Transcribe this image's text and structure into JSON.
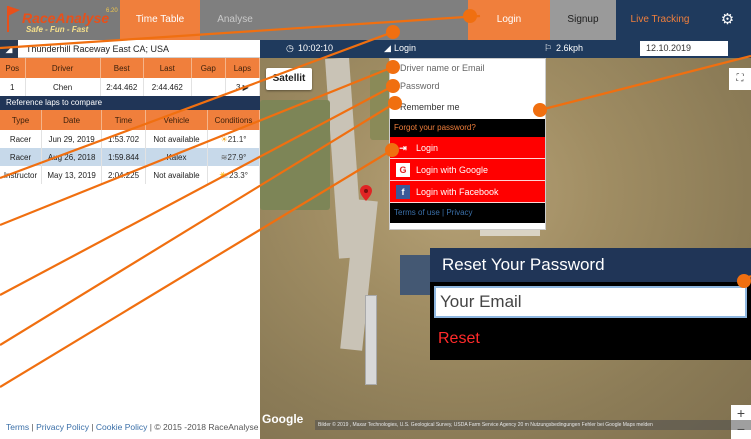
{
  "brand": {
    "name": "RaceAnalyse",
    "version": "6.20",
    "tagline": "Safe - Fun - Fast"
  },
  "nav": {
    "timetable": "Time Table",
    "analyse": "Analyse",
    "login": "Login",
    "signup": "Signup",
    "live": "Live Tracking",
    "settings_icon": "gear-icon"
  },
  "track": {
    "name": "Thunderhill Raceway East CA; USA"
  },
  "table": {
    "columns": [
      "Pos",
      "Driver",
      "Best",
      "Last",
      "Gap",
      "Laps"
    ],
    "rows": [
      {
        "pos": "1",
        "driver": "Chen",
        "best": "2:44.462",
        "last": "2:44.462",
        "gap": "",
        "laps": "3"
      }
    ]
  },
  "reference": {
    "caption": "Reference laps to compare",
    "columns": [
      "Type",
      "Date",
      "Time",
      "Vehicle",
      "Conditions"
    ],
    "rows": [
      {
        "type": "Racer",
        "date": "Jun 29, 2019",
        "time": "1:53.702",
        "vehicle": "Not available",
        "cond": "21.1°",
        "icon": "sun-icon"
      },
      {
        "type": "Racer",
        "date": "Aug 26, 2018",
        "time": "1:59.844",
        "vehicle": "Kalex",
        "cond": "27.9°",
        "icon": "wind-icon"
      },
      {
        "type": "Instructor",
        "date": "May 13, 2019",
        "time": "2:04.225",
        "vehicle": "Not available",
        "cond": "23.3°",
        "icon": "partly-cloudy-icon"
      }
    ]
  },
  "footer": {
    "terms": "Terms",
    "privacy": "Privacy Policy",
    "cookie": "Cookie Policy",
    "copy": "© 2015 -2018 RaceAnalyse"
  },
  "mapbar": {
    "clock": "10:02:10",
    "login_label": "Login",
    "speed": "2.6kph",
    "date": "12.10.2019"
  },
  "map": {
    "satellite": "Satellit",
    "google": "Google",
    "attribution": "Bilder © 2019 , Maxar Technologies, U.S. Geological Survey, USDA Farm Service Agency   20 m   Nutzungsbedingungen   Fehler bei Google Maps melden"
  },
  "login_dropdown": {
    "user_placeholder": "Driver name or Email",
    "password_placeholder": "Password",
    "remember": "Remember me",
    "forgot": "Forgot your password?",
    "login_btn": "Login",
    "google_btn": "Login with Google",
    "facebook_btn": "Login with Facebook",
    "terms": "Terms of use",
    "privacy": "Privacy"
  },
  "reset": {
    "title": "Reset Your Password",
    "email_placeholder": "Your Email",
    "button": "Reset"
  },
  "colors": {
    "orange": "#f07f3c",
    "navy": "#1f3a5d",
    "red": "#ff0000"
  }
}
